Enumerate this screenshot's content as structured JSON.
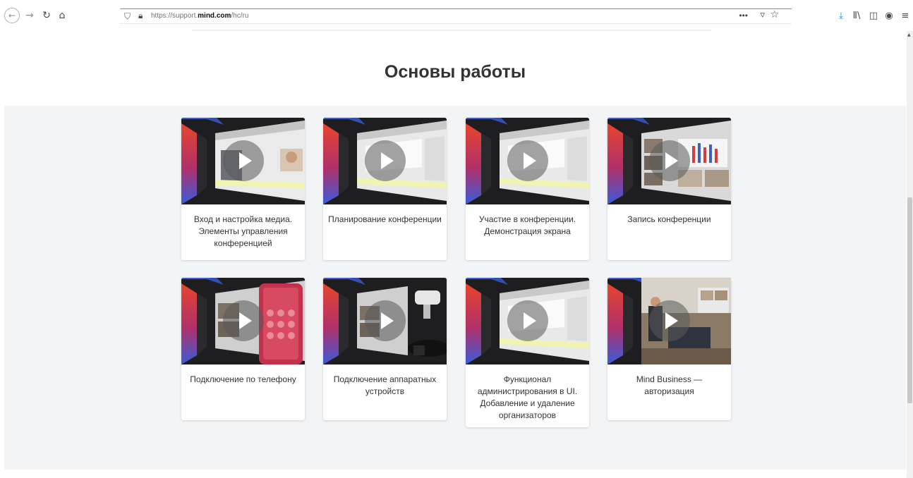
{
  "browser": {
    "back_icon": "←",
    "forward_icon": "→",
    "reload_icon": "↻",
    "home_icon": "⌂",
    "url_prefix": "https://support.",
    "url_domain": "mind.com",
    "url_path": "/hc/ru",
    "more_label": "•••",
    "pocket_icon": "▿",
    "star_icon": "☆",
    "download_icon": "⤓",
    "library_icon": "Ⅱ\\",
    "sidebar_icon": "◫",
    "account_icon": "◉",
    "menu_icon": "≡"
  },
  "page": {
    "title": "Основы работы"
  },
  "cards": [
    {
      "caption": "Вход и настройка медиа. Элементы управления конференцией",
      "scene": "people"
    },
    {
      "caption": "Планирование конференции",
      "scene": "app"
    },
    {
      "caption": "Участие в конференции. Демонстрация экрана",
      "scene": "app"
    },
    {
      "caption": "Запись конференции",
      "scene": "grid"
    },
    {
      "caption": "Подключение по телефону",
      "scene": "phone"
    },
    {
      "caption": "Подключение аппаратных устройств",
      "scene": "devices"
    },
    {
      "caption": "Функционал администрирования в UI. Добавление и удаление организаторов",
      "scene": "app"
    },
    {
      "caption": "Mind Business — авторизация",
      "scene": "office"
    }
  ],
  "colors": {
    "accent_red": "#e8452c",
    "accent_blue": "#3a5bd9",
    "section_bg": "#f3f4f6"
  }
}
